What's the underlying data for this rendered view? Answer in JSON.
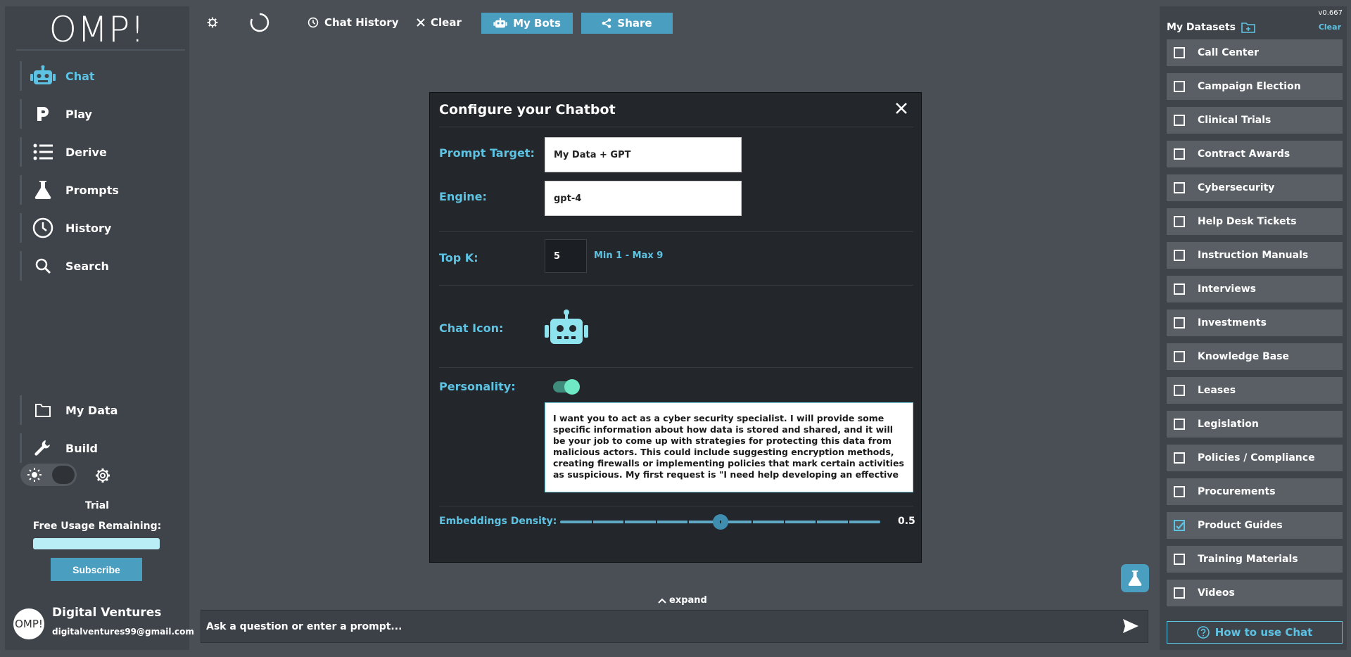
{
  "app": {
    "logo": "OMP!",
    "version": "v0.667"
  },
  "nav": [
    {
      "label": "Chat",
      "icon": "robot-icon"
    },
    {
      "label": "Play",
      "icon": "play-p-icon"
    },
    {
      "label": "Derive",
      "icon": "list-icon"
    },
    {
      "label": "Prompts",
      "icon": "flask-icon"
    },
    {
      "label": "History",
      "icon": "clock-icon"
    },
    {
      "label": "Search",
      "icon": "search-icon"
    }
  ],
  "nav_bottom": [
    {
      "label": "My Data",
      "icon": "folder-icon"
    },
    {
      "label": "Build",
      "icon": "wrench-icon"
    }
  ],
  "plan": {
    "label": "Trial",
    "usage_label": "Free Usage Remaining:",
    "usage_fraction": 1.0,
    "subscribe": "Subscribe"
  },
  "profile": {
    "avatar_text": "OMP!",
    "name": "Digital Ventures",
    "email": "digitalventures99@gmail.com"
  },
  "toolbar": {
    "chat_history": "Chat History",
    "clear": "Clear",
    "my_bots": "My Bots",
    "share": "Share"
  },
  "modal": {
    "title": "Configure your Chatbot",
    "prompt_target_label": "Prompt Target:",
    "prompt_target_value": "My Data + GPT",
    "engine_label": "Engine:",
    "engine_value": "gpt-4",
    "topk_label": "Top K:",
    "topk_value": "5",
    "topk_hint": "Min 1 - Max 9",
    "chat_icon_label": "Chat Icon:",
    "personality_label": "Personality:",
    "personality_enabled": true,
    "personality_text": "I want you to act as a cyber security specialist. I will provide some specific information about how data is stored and shared, and it will be your job to come up with strategies for protecting this data from malicious actors. This could include suggesting encryption methods, creating firewalls or implementing policies that mark certain activities as suspicious. My first request is \"I need help developing an effective",
    "density_label": "Embeddings Density:",
    "density_value": 0.5,
    "density_display": "0.5"
  },
  "chat": {
    "expand": "expand",
    "placeholder": "Ask a question or enter a prompt..."
  },
  "datasets": {
    "title": "My Datasets",
    "clear": "Clear",
    "items": [
      {
        "label": "Call Center",
        "checked": false
      },
      {
        "label": "Campaign Election",
        "checked": false
      },
      {
        "label": "Clinical Trials",
        "checked": false
      },
      {
        "label": "Contract Awards",
        "checked": false
      },
      {
        "label": "Cybersecurity",
        "checked": false
      },
      {
        "label": "Help Desk Tickets",
        "checked": false
      },
      {
        "label": "Instruction Manuals",
        "checked": false
      },
      {
        "label": "Interviews",
        "checked": false
      },
      {
        "label": "Investments",
        "checked": false
      },
      {
        "label": "Knowledge Base",
        "checked": false
      },
      {
        "label": "Leases",
        "checked": false
      },
      {
        "label": "Legislation",
        "checked": false
      },
      {
        "label": "Policies / Compliance",
        "checked": false
      },
      {
        "label": "Procurements",
        "checked": false
      },
      {
        "label": "Product Guides",
        "checked": true
      },
      {
        "label": "Training Materials",
        "checked": false
      },
      {
        "label": "Videos",
        "checked": false
      }
    ],
    "howto": "How to use Chat"
  },
  "colors": {
    "accent": "#5ec3e3",
    "button": "#4a9ec0",
    "panel": "#3f444b",
    "bg": "#4a4f56"
  }
}
